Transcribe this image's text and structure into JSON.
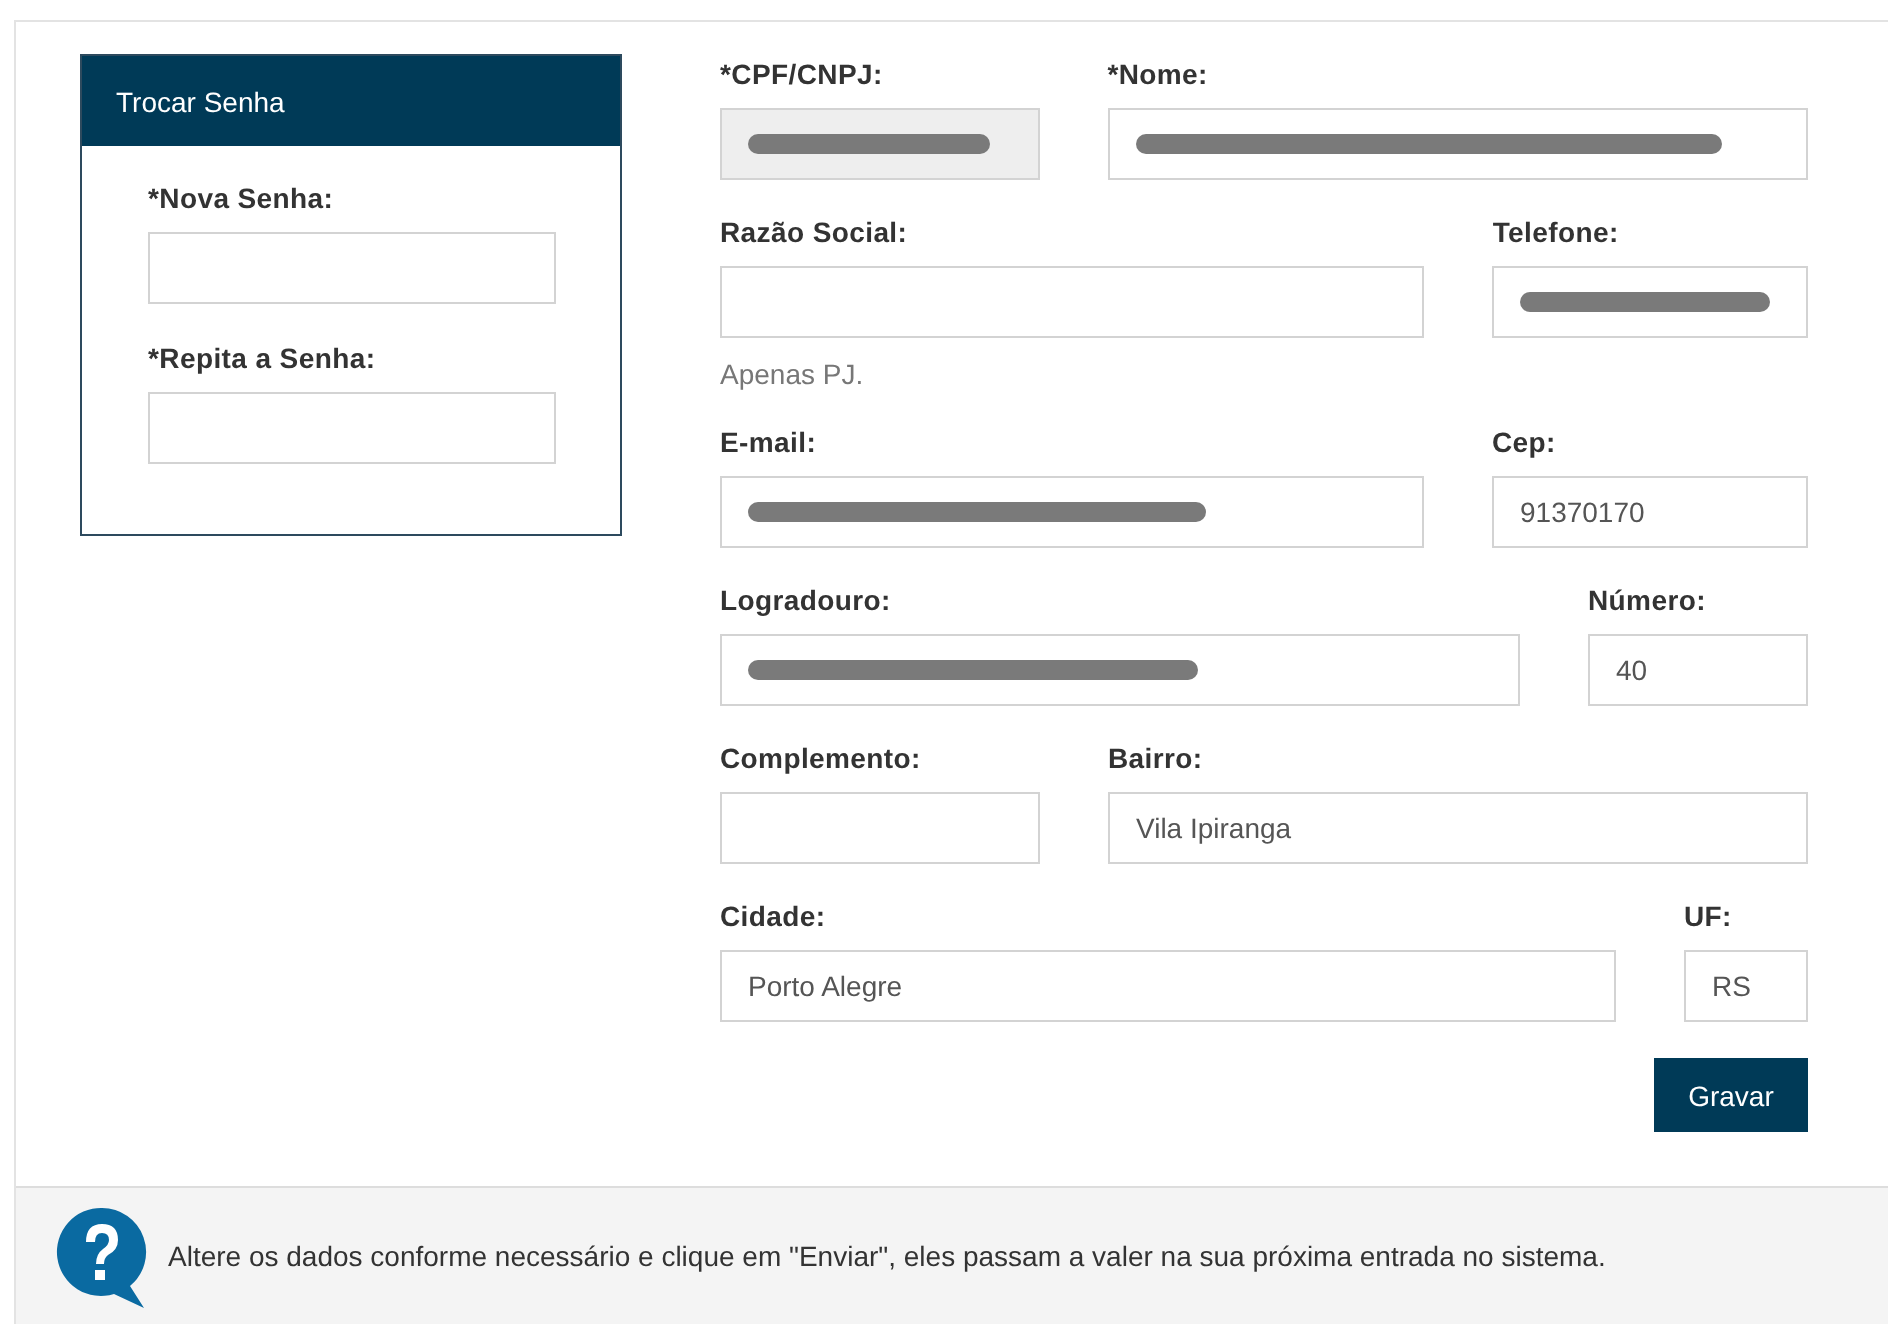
{
  "password_panel": {
    "title": "Trocar Senha",
    "fields": [
      {
        "label": "*Nova Senha:"
      },
      {
        "label": "*Repita a Senha:"
      }
    ]
  },
  "form": {
    "rows": [
      [
        {
          "label": "*CPF/CNPJ:",
          "disabled": true,
          "redacted": true
        },
        {
          "label": "*Nome:",
          "disabled": false,
          "redacted": true
        }
      ],
      [
        {
          "label": "Razão Social:",
          "disabled": false,
          "redacted": false,
          "hint": "Apenas PJ."
        },
        {
          "label": "Telefone:",
          "disabled": false,
          "redacted": true
        }
      ],
      [
        {
          "label": "E-mail:",
          "disabled": false,
          "redacted": true
        },
        {
          "label": "Cep:",
          "disabled": false,
          "redacted": false,
          "value": "91370170"
        }
      ],
      [
        {
          "label": "Logradouro:",
          "disabled": false,
          "redacted": true
        },
        {
          "label": "Número:",
          "disabled": false,
          "redacted": false,
          "value": "40"
        }
      ],
      [
        {
          "label": "Complemento:",
          "disabled": false,
          "redacted": false
        },
        {
          "label": "Bairro:",
          "disabled": false,
          "redacted": false,
          "value": "Vila Ipiranga"
        }
      ],
      [
        {
          "label": "Cidade:",
          "disabled": false,
          "redacted": false,
          "value": "Porto Alegre"
        },
        {
          "label": "UF:",
          "disabled": false,
          "redacted": false,
          "value": "RS"
        }
      ]
    ],
    "save_button": "Gravar"
  },
  "help": {
    "text": "Altere os dados conforme necessário e clique em \"Enviar\", eles passam a valer na sua próxima entrada no sistema."
  }
}
